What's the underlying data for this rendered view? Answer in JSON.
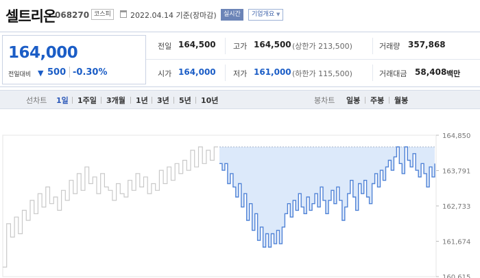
{
  "header": {
    "stock_name": "셀트리온",
    "stock_code": "068270",
    "market": "코스피",
    "date_text": "2022.04.14 기준(장마감)",
    "realtime_label": "실시간",
    "company_label": "기업개요"
  },
  "quote": {
    "current_price": "164,000",
    "change_label": "전일대비",
    "change_arrow": "▼",
    "change_value": "500",
    "change_pct": "-0.30%",
    "prev_close_label": "전일",
    "prev_close": "164,500",
    "high_label": "고가",
    "high": "164,500",
    "upper_limit": "(상한가 213,500)",
    "volume_label": "거래량",
    "volume": "357,868",
    "open_label": "시가",
    "open": "164,000",
    "low_label": "저가",
    "low": "161,000",
    "lower_limit": "(하한가 115,500)",
    "amount_label": "거래대금",
    "amount": "58,408",
    "amount_unit": "백만"
  },
  "toolbar": {
    "line_label": "선차트",
    "line_periods": [
      "1일",
      "1주일",
      "3개월",
      "1년",
      "3년",
      "5년",
      "10년"
    ],
    "active_period": "1일",
    "candle_label": "봉차트",
    "candle_periods": [
      "일봉",
      "주봉",
      "월봉"
    ]
  },
  "colors": {
    "accent_blue": "#1b5dc6",
    "today_line": "#4f82d6",
    "today_fill": "#dce9fa",
    "prev_line": "#c8c8c8"
  },
  "chart_data": {
    "type": "line",
    "y_ticks": [
      "164,850",
      "163,791",
      "162,733",
      "161,674",
      "160,615"
    ],
    "ylim": [
      160615,
      164850
    ],
    "reference_value": 164500,
    "series": [
      {
        "values": [
          160900,
          162200,
          161800,
          162400,
          161900,
          162600,
          162300,
          162900,
          162500,
          163100,
          162700,
          163300,
          162800,
          163000,
          162600,
          163200,
          162900,
          163500,
          163100,
          163700,
          163200,
          163900,
          163400,
          163600,
          163100,
          163700,
          163300,
          163200,
          162900,
          163400,
          163100,
          163000,
          163500,
          163200,
          163700,
          163300,
          163600,
          163100,
          163400,
          163200,
          163800,
          163400,
          163900,
          163500,
          164000,
          163700,
          164100,
          163800,
          164400,
          163900,
          164500,
          164000,
          164400,
          164100,
          164500,
          164500
        ]
      },
      {
        "values": [
          164000,
          163800,
          164000,
          163400,
          163700,
          163300,
          163000,
          163400,
          162700,
          163100,
          162300,
          162800,
          162000,
          162500,
          161700,
          162100,
          161500,
          161900,
          161500,
          161900,
          161600,
          162000,
          161600,
          162100,
          162500,
          162800,
          162400,
          162900,
          162600,
          163100,
          162700,
          162500,
          163000,
          162600,
          162800,
          163100,
          162700,
          163300,
          162900,
          162500,
          162900,
          163200,
          162800,
          163300,
          162900,
          162300,
          162700,
          163100,
          163500,
          163000,
          162600,
          163400,
          163100,
          163500,
          163000,
          162800,
          163400,
          163700,
          163300,
          163800,
          163500,
          163900,
          164100,
          163800,
          164200,
          164500,
          164000,
          163700,
          164500,
          164100,
          163900,
          164300,
          163800,
          163600,
          164000,
          163700,
          163300,
          163900,
          163600,
          164000
        ]
      }
    ]
  }
}
